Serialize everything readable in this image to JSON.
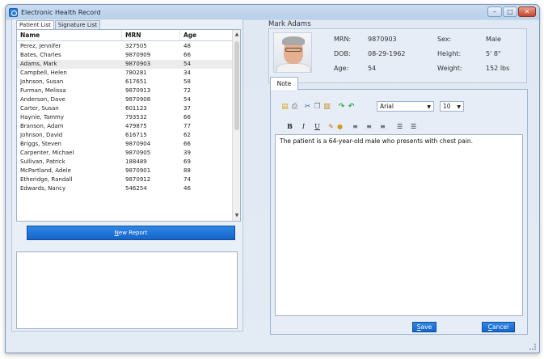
{
  "window": {
    "title": "Electronic Health Record"
  },
  "left_panel": {
    "tabs": [
      {
        "label": "Patient List",
        "active": true
      },
      {
        "label": "Signature List",
        "active": false
      }
    ],
    "columns": [
      "Name",
      "MRN",
      "Age"
    ],
    "rows": [
      {
        "name": "Perez, Jennifer",
        "mrn": "327505",
        "age": "48"
      },
      {
        "name": "Bates, Charles",
        "mrn": "9870909",
        "age": "66"
      },
      {
        "name": "Adams, Mark",
        "mrn": "9870903",
        "age": "54",
        "selected": true
      },
      {
        "name": "Campbell, Helen",
        "mrn": "780281",
        "age": "34"
      },
      {
        "name": "Johnson, Susan",
        "mrn": "617651",
        "age": "58"
      },
      {
        "name": "Furman, Melissa",
        "mrn": "9870913",
        "age": "72"
      },
      {
        "name": "Anderson, Dave",
        "mrn": "9870908",
        "age": "54"
      },
      {
        "name": "Carter, Susan",
        "mrn": "601123",
        "age": "37"
      },
      {
        "name": "Haynie, Tammy",
        "mrn": "793532",
        "age": "66"
      },
      {
        "name": "Branson, Adam",
        "mrn": "479875",
        "age": "77"
      },
      {
        "name": "Johnson, David",
        "mrn": "616715",
        "age": "62"
      },
      {
        "name": "Briggs, Steven",
        "mrn": "9870904",
        "age": "66"
      },
      {
        "name": "Carpenter, Michael",
        "mrn": "9870905",
        "age": "39"
      },
      {
        "name": "Sullivan, Patrick",
        "mrn": "188489",
        "age": "69"
      },
      {
        "name": "McPartland, Adele",
        "mrn": "9870901",
        "age": "88"
      },
      {
        "name": "Etheridge, Randall",
        "mrn": "9870912",
        "age": "74"
      },
      {
        "name": "Edwards, Nancy",
        "mrn": "546254",
        "age": "46"
      }
    ],
    "new_report_mnemonic": "N",
    "new_report_rest": "ew Report"
  },
  "patient": {
    "name": "Mark Adams",
    "mrn_label": "MRN:",
    "mrn": "9870903",
    "dob_label": "DOB:",
    "dob": "08-29-1962",
    "age_label": "Age:",
    "age": "54",
    "sex_label": "Sex:",
    "sex": "Male",
    "height_label": "Height:",
    "height": "5' 8\"",
    "weight_label": "Weight:",
    "weight": "152 lbs"
  },
  "note": {
    "tab_label": "Note",
    "font": "Arial",
    "size": "10",
    "formatting": {
      "bold": "B",
      "italic": "I",
      "underline": "U"
    },
    "text": "The patient is a 64-year-old male who presents with chest pain.",
    "save_mnemonic": "S",
    "save_rest": "ave",
    "cancel_mnemonic": "C",
    "cancel_rest": "ancel"
  },
  "colors": {
    "accent_button": "#1e75d8",
    "panel_bg": "#e6edf6",
    "selected_row": "#ececec"
  }
}
